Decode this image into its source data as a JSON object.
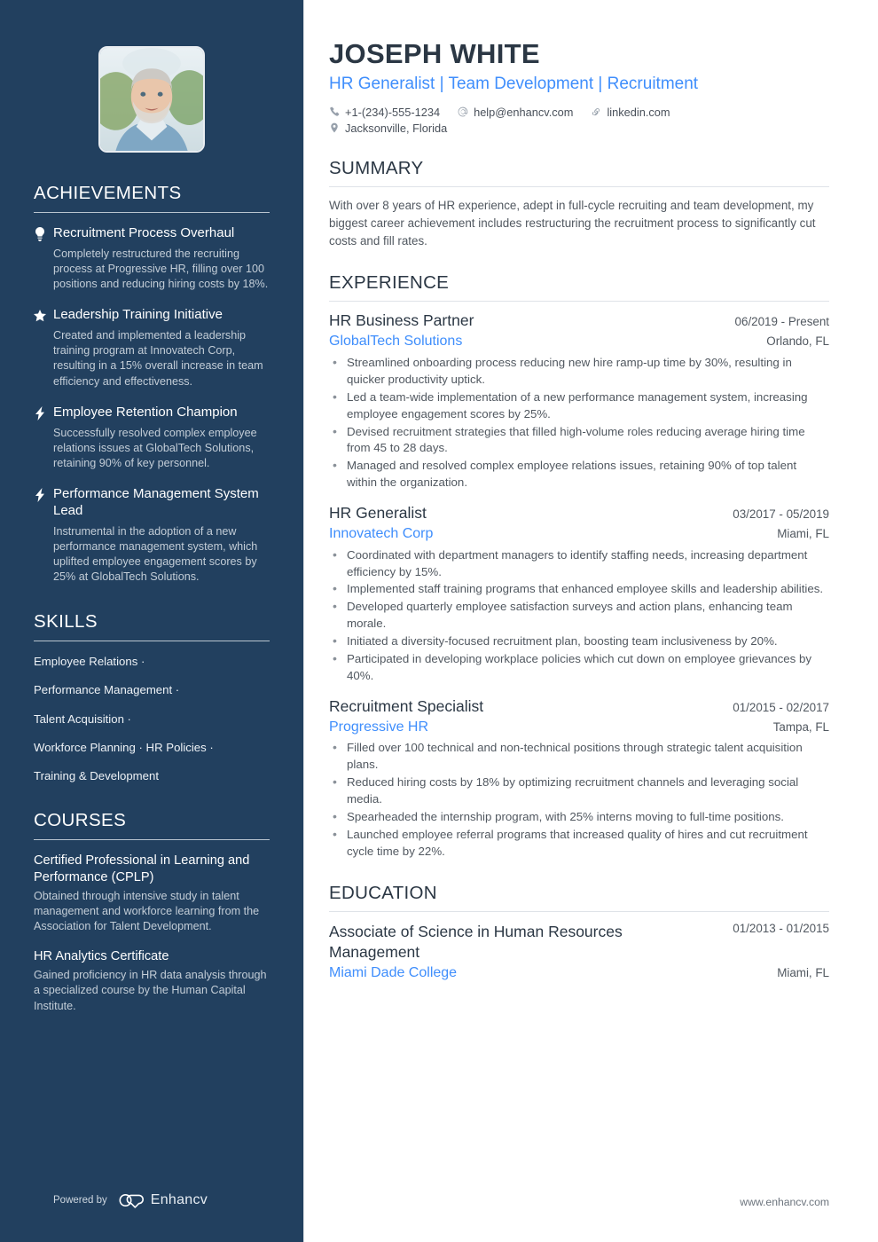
{
  "profile": {
    "name": "JOSEPH WHITE",
    "headline": "HR Generalist | Team Development | Recruitment",
    "photo_alt": "profile-photo"
  },
  "contacts": [
    {
      "icon": "phone-icon",
      "value": "+1-(234)-555-1234"
    },
    {
      "icon": "email-icon",
      "value": "help@enhancv.com"
    },
    {
      "icon": "link-icon",
      "value": "linkedin.com"
    },
    {
      "icon": "location-icon",
      "value": "Jacksonville, Florida"
    }
  ],
  "sidebar": {
    "achievements": {
      "heading": "ACHIEVEMENTS",
      "items": [
        {
          "icon": "lightbulb-icon",
          "title": "Recruitment Process Overhaul",
          "desc": "Completely restructured the recruiting process at Progressive HR, filling over 100 positions and reducing hiring costs by 18%."
        },
        {
          "icon": "star-icon",
          "title": "Leadership Training Initiative",
          "desc": "Created and implemented a leadership training program at Innovatech Corp, resulting in a 15% overall increase in team efficiency and effectiveness."
        },
        {
          "icon": "bolt-icon",
          "title": "Employee Retention Champion",
          "desc": "Successfully resolved complex employee relations issues at GlobalTech Solutions, retaining 90% of key personnel."
        },
        {
          "icon": "bolt-icon",
          "title": "Performance Management System Lead",
          "desc": "Instrumental in the adoption of a new performance management system, which uplifted employee engagement scores by 25% at GlobalTech Solutions."
        }
      ]
    },
    "skills": {
      "heading": "SKILLS",
      "lines": [
        "Employee Relations ·",
        "Performance Management ·",
        "Talent Acquisition ·",
        "Workforce Planning · HR Policies ·",
        "Training & Development"
      ]
    },
    "courses": {
      "heading": "COURSES",
      "items": [
        {
          "title": "Certified Professional in Learning and Performance (CPLP)",
          "desc": "Obtained through intensive study in talent management and workforce learning from the Association for Talent Development."
        },
        {
          "title": "HR Analytics Certificate",
          "desc": "Gained proficiency in HR data analysis through a specialized course by the Human Capital Institute."
        }
      ]
    },
    "footer": {
      "powered_by": "Powered by",
      "brand": "Enhancv"
    }
  },
  "main": {
    "summary": {
      "heading": "SUMMARY",
      "text": "With over 8 years of HR experience, adept in full-cycle recruiting and team development, my biggest career achievement includes restructuring the recruitment process to significantly cut costs and fill rates."
    },
    "experience": {
      "heading": "EXPERIENCE",
      "entries": [
        {
          "title": "HR Business Partner",
          "dates": "06/2019 - Present",
          "org": "GlobalTech Solutions",
          "location": "Orlando, FL",
          "bullets": [
            "Streamlined onboarding process reducing new hire ramp-up time by 30%, resulting in quicker productivity uptick.",
            "Led a team-wide implementation of a new performance management system, increasing employee engagement scores by 25%.",
            "Devised recruitment strategies that filled high-volume roles reducing average hiring time from 45 to 28 days.",
            "Managed and resolved complex employee relations issues, retaining 90% of top talent within the organization."
          ]
        },
        {
          "title": "HR Generalist",
          "dates": "03/2017 - 05/2019",
          "org": "Innovatech Corp",
          "location": "Miami, FL",
          "bullets": [
            "Coordinated with department managers to identify staffing needs, increasing department efficiency by 15%.",
            "Implemented staff training programs that enhanced employee skills and leadership abilities.",
            "Developed quarterly employee satisfaction surveys and action plans, enhancing team morale.",
            "Initiated a diversity-focused recruitment plan, boosting team inclusiveness by 20%.",
            "Participated in developing workplace policies which cut down on employee grievances by 40%."
          ]
        },
        {
          "title": "Recruitment Specialist",
          "dates": "01/2015 - 02/2017",
          "org": "Progressive HR",
          "location": "Tampa, FL",
          "bullets": [
            "Filled over 100 technical and non-technical positions through strategic talent acquisition plans.",
            "Reduced hiring costs by 18% by optimizing recruitment channels and leveraging social media.",
            "Spearheaded the internship program, with 25% interns moving to full-time positions.",
            "Launched employee referral programs that increased quality of hires and cut recruitment cycle time by 22%."
          ]
        }
      ]
    },
    "education": {
      "heading": "EDUCATION",
      "entries": [
        {
          "title": "Associate of Science in Human Resources Management",
          "dates": "01/2013 - 01/2015",
          "org": "Miami Dade College",
          "location": "Miami, FL"
        }
      ]
    },
    "website": "www.enhancv.com"
  },
  "colors": {
    "sidebar_bg": "#22405f",
    "accent_blue": "#3f8efc",
    "heading_dark": "#2b3744",
    "body_text": "#515860"
  }
}
